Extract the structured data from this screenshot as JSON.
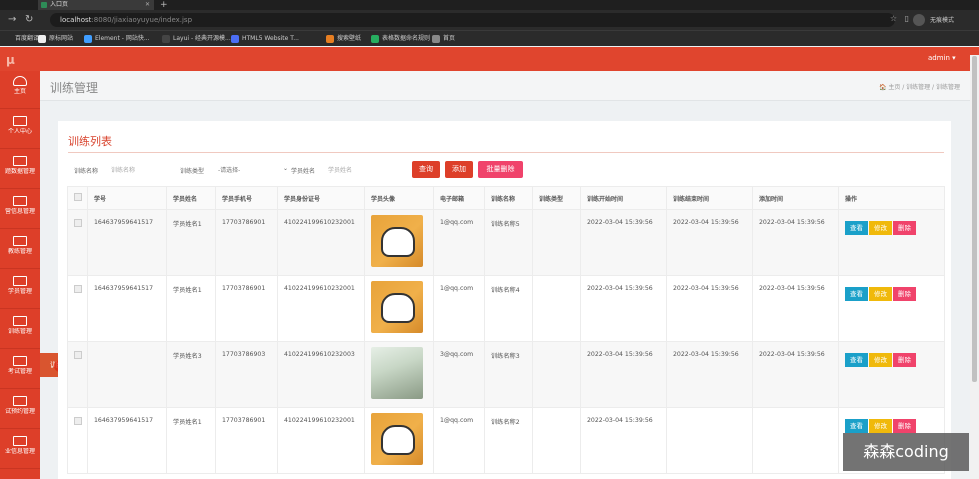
{
  "browser": {
    "tab_title": "入口页",
    "new_tab": "+",
    "url_host": "localhost",
    "url_rest": ":8080/jiaxiaoyuyue/index.jsp",
    "profile_label": "无痕模式",
    "bookmarks": [
      {
        "label": "百度翻译",
        "color": ""
      },
      {
        "label": "原标网站",
        "color": "#eee"
      },
      {
        "label": "Element - 网站快...",
        "color": "#409eff"
      },
      {
        "label": "Layui - 经典开源模...",
        "color": "#444"
      },
      {
        "label": "HTML5 Website T...",
        "color": "#4c6ef5"
      },
      {
        "label": "搜索壁纸",
        "color": "#e67e22"
      },
      {
        "label": "表格数据命名规则",
        "color": "#27ae60"
      },
      {
        "label": "首页",
        "color": "#888"
      }
    ]
  },
  "app": {
    "logo": "μ",
    "user": "admin ▾",
    "sidebar": [
      {
        "label": "主页",
        "icon": "dashboard-icon"
      },
      {
        "label": "个人中心",
        "icon": "monitor-icon"
      },
      {
        "label": "题数据管理",
        "icon": "monitor-icon"
      },
      {
        "label": "营信息管理",
        "icon": "monitor-icon"
      },
      {
        "label": "教练管理",
        "icon": "monitor-icon"
      },
      {
        "label": "学员管理",
        "icon": "monitor-icon"
      },
      {
        "label": "训练管理",
        "icon": "monitor-icon"
      },
      {
        "label": "考试管理",
        "icon": "monitor-icon"
      },
      {
        "label": "试预约管理",
        "icon": "monitor-icon"
      },
      {
        "label": "业信息管理",
        "icon": "monitor-icon"
      }
    ],
    "flyout": "训练管理",
    "page_title": "训练管理",
    "breadcrumb": "🏠 主页 / 训练管理 / 训练管理"
  },
  "panel": {
    "title": "训练列表",
    "filters": {
      "name_label": "训练名称",
      "name_placeholder": "训练名称",
      "type_label": "训练类型",
      "type_selected": "-请选择-",
      "student_label": "学员姓名",
      "student_placeholder": "学员姓名"
    },
    "buttons": {
      "search": "查询",
      "add": "添加",
      "batch_delete": "批量删除"
    },
    "columns": [
      "学号",
      "学员姓名",
      "学员手机号",
      "学员身份证号",
      "学员头像",
      "电子邮箱",
      "训练名称",
      "训练类型",
      "训练开始时间",
      "训练结束时间",
      "添加时间",
      "操作"
    ],
    "rows": [
      {
        "id": "164637959641517",
        "name": "学员姓名1",
        "phone": "17703786901",
        "idcard": "410224199610232001",
        "avatar": "cartoon",
        "email": "1@qq.com",
        "train_name": "训练名称5",
        "train_type": "",
        "start": "2022-03-04 15:39:56",
        "end": "2022-03-04 15:39:56",
        "added": "2022-03-04 15:39:56"
      },
      {
        "id": "164637959641517",
        "name": "学员姓名1",
        "phone": "17703786901",
        "idcard": "410224199610232001",
        "avatar": "cartoon",
        "email": "1@qq.com",
        "train_name": "训练名称4",
        "train_type": "",
        "start": "2022-03-04 15:39:56",
        "end": "2022-03-04 15:39:56",
        "added": "2022-03-04 15:39:56"
      },
      {
        "id": "",
        "name": "学员姓名3",
        "phone": "17703786903",
        "idcard": "410224199610232003",
        "avatar": "photo",
        "email": "3@qq.com",
        "train_name": "训练名称3",
        "train_type": "",
        "start": "2022-03-04 15:39:56",
        "end": "2022-03-04 15:39:56",
        "added": "2022-03-04 15:39:56"
      },
      {
        "id": "164637959641517",
        "name": "学员姓名1",
        "phone": "17703786901",
        "idcard": "410224199610232001",
        "avatar": "cartoon",
        "email": "1@qq.com",
        "train_name": "训练名称2",
        "train_type": "",
        "start": "2022-03-04 15:39:56",
        "end": "",
        "added": ""
      }
    ],
    "row_actions": {
      "view": "查看",
      "edit": "修改",
      "delete": "删除"
    }
  },
  "colors": {
    "accent": "#dd3f29",
    "view": "#1aa0c9",
    "edit": "#f0b90b",
    "delete": "#f0436b"
  },
  "watermark": "森森coding"
}
